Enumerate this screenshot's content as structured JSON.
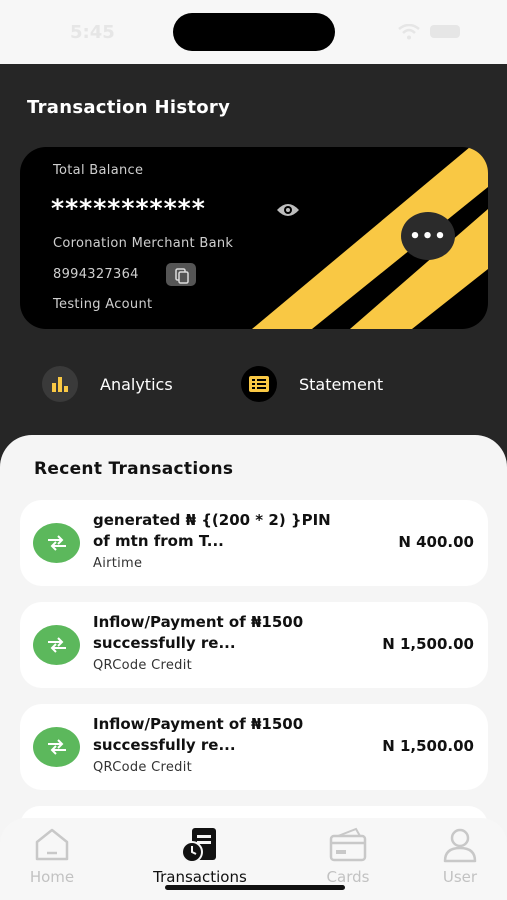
{
  "status_bar": {
    "time": "5:45"
  },
  "header": {
    "title": "Transaction History"
  },
  "card": {
    "balance_label": "Total Balance",
    "masked_balance": "***********",
    "bank_name": "Coronation Merchant Bank",
    "account_number": "8994327364",
    "account_name": "Testing Acount",
    "more_label": "•••",
    "stripe_color": "#f9c844"
  },
  "actions": [
    {
      "label": "Analytics",
      "icon": "bar-chart-icon"
    },
    {
      "label": "Statement",
      "icon": "statement-icon"
    }
  ],
  "recent": {
    "title": "Recent Transactions",
    "items": [
      {
        "title": "generated  ₦ {(200 * 2)  }PIN of  mtn from T...",
        "category": "Airtime",
        "amount": "N 400.00"
      },
      {
        "title": "Inflow/Payment of ₦1500 successfully re...",
        "category": "QRCode Credit",
        "amount": "N 1,500.00"
      },
      {
        "title": "Inflow/Payment of ₦1500 successfully re...",
        "category": "QRCode Credit",
        "amount": "N 1,500.00"
      }
    ],
    "icon_color": "#5cb85c"
  },
  "nav": [
    {
      "label": "Home",
      "icon": "home-icon"
    },
    {
      "label": "Transactions",
      "icon": "transactions-icon",
      "active": true
    },
    {
      "label": "Cards",
      "icon": "card-icon"
    },
    {
      "label": "User",
      "icon": "user-icon"
    }
  ]
}
